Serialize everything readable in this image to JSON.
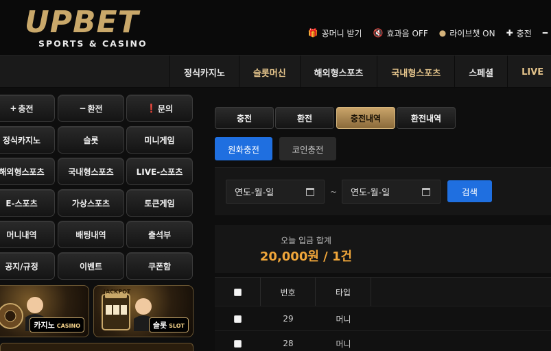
{
  "brand": {
    "logo_text": "UPBET",
    "tagline": "SPORTS & CASINO",
    "accent": "#c9a86a"
  },
  "top_links": [
    {
      "icon": "gift-icon",
      "label": "꽁머니 받기"
    },
    {
      "icon": "speaker-mute-icon",
      "label": "효과음 OFF"
    },
    {
      "icon": "chat-icon",
      "label": "라이브챗 ON"
    },
    {
      "icon": "plus-icon",
      "label": "충전"
    }
  ],
  "nav": [
    {
      "label": "정식카지노"
    },
    {
      "label": "슬롯머신"
    },
    {
      "label": "해외형스포츠"
    },
    {
      "label": "국내형스포츠"
    },
    {
      "label": "스페셜"
    },
    {
      "label": "LIVE"
    }
  ],
  "sidebar": {
    "buttons": [
      {
        "icon": "plus-icon",
        "label": "충전"
      },
      {
        "icon": "minus-icon",
        "label": "환전"
      },
      {
        "icon": "info-icon",
        "label": "문의"
      },
      {
        "label": "정식카지노"
      },
      {
        "label": "슬롯"
      },
      {
        "label": "미니게임"
      },
      {
        "label": "해외형스포츠"
      },
      {
        "label": "국내형스포츠"
      },
      {
        "label": "LIVE-스포츠"
      },
      {
        "label": "E-스포츠"
      },
      {
        "label": "가상스포츠"
      },
      {
        "label": "토큰게임"
      },
      {
        "label": "머니내역"
      },
      {
        "label": "배팅내역"
      },
      {
        "label": "출석부"
      },
      {
        "label": "공지/규정"
      },
      {
        "label": "이벤트"
      },
      {
        "label": "쿠폰함"
      }
    ],
    "banners": [
      {
        "label": "카지노",
        "sub": "CASINO"
      },
      {
        "label": "슬롯",
        "sub": "SLOT",
        "badge": "JACKPOT"
      }
    ]
  },
  "tabs": [
    {
      "label": "충전",
      "active": false
    },
    {
      "label": "환전",
      "active": false
    },
    {
      "label": "충전내역",
      "active": true
    },
    {
      "label": "환전내역",
      "active": false
    }
  ],
  "sub_tabs": [
    {
      "label": "원화충전",
      "active": true
    },
    {
      "label": "코인충전",
      "active": false
    }
  ],
  "search": {
    "date_from": "연도-월-일",
    "date_to": "연도-월-일",
    "separator": "~",
    "button": "검색"
  },
  "summary": {
    "label": "오늘 입금 합계",
    "value": "20,000원 / 1건"
  },
  "table": {
    "columns": [
      "",
      "번호",
      "타입"
    ],
    "rows": [
      {
        "no": "29",
        "type": "머니"
      },
      {
        "no": "28",
        "type": "머니"
      }
    ]
  }
}
